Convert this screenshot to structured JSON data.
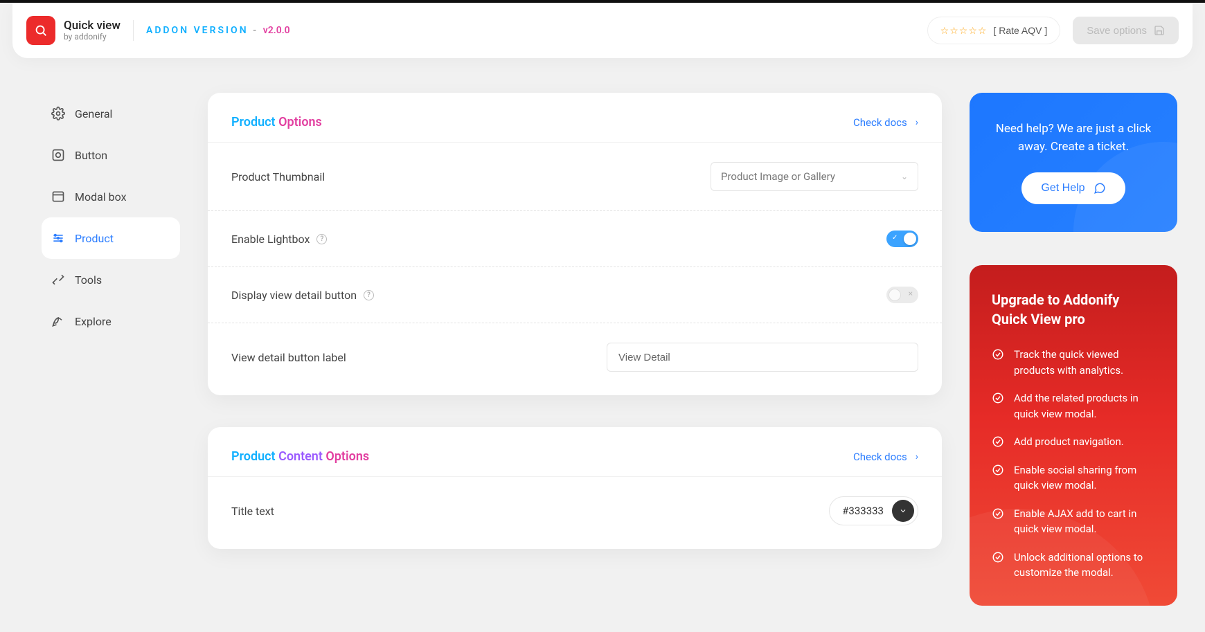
{
  "header": {
    "brand_title": "Quick view",
    "brand_sub": "by addonify",
    "addon_label": "ADDON VERSION",
    "version": "v2.0.0",
    "rate_label": "[ Rate AQV ]",
    "save_label": "Save options"
  },
  "sidebar": {
    "items": [
      {
        "label": "General"
      },
      {
        "label": "Button"
      },
      {
        "label": "Modal box"
      },
      {
        "label": "Product"
      },
      {
        "label": "Tools"
      },
      {
        "label": "Explore"
      }
    ]
  },
  "card1": {
    "title_w1": "Product",
    "title_w3": "Options",
    "docs": "Check docs",
    "thumbnail_label": "Product Thumbnail",
    "thumbnail_value": "Product Image or Gallery",
    "lightbox_label": "Enable Lightbox",
    "detail_btn_label": "Display view detail button",
    "detail_input_label": "View detail button label",
    "detail_input_value": "View Detail"
  },
  "card2": {
    "title_w1": "Product",
    "title_w2": "Content",
    "title_w3": "Options",
    "docs": "Check docs",
    "title_text_label": "Title text",
    "title_color_value": "#333333"
  },
  "help": {
    "text": "Need help? We are just a click away. Create a ticket.",
    "button": "Get Help"
  },
  "upgrade": {
    "title": "Upgrade to Addonify Quick View pro",
    "items": [
      "Track the quick viewed products with analytics.",
      "Add the related products in quick view modal.",
      "Add product navigation.",
      "Enable social sharing from quick view modal.",
      "Enable AJAX add to cart in quick view modal.",
      "Unlock additional options to customize the modal."
    ]
  }
}
